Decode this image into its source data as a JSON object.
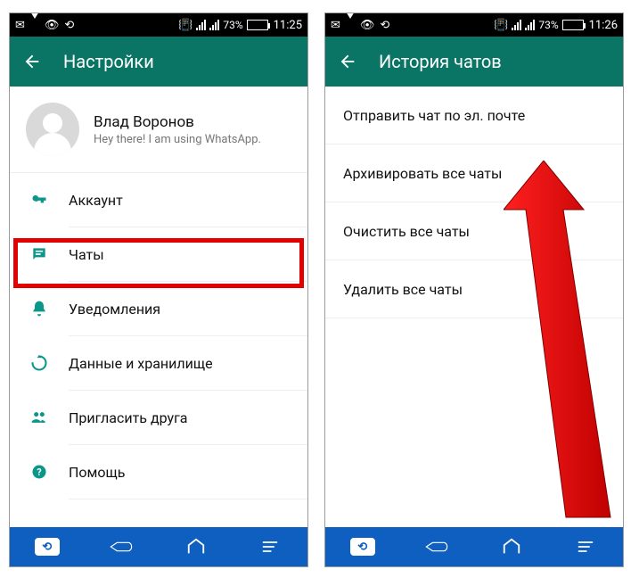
{
  "screen1": {
    "status": {
      "battery": "73%",
      "time": "11:25"
    },
    "appbar": {
      "title": "Настройки"
    },
    "profile": {
      "name": "Влад Воронов",
      "status": "Hey there! I am using WhatsApp."
    },
    "menu": {
      "account": "Аккаунт",
      "chats": "Чаты",
      "notifications": "Уведомления",
      "storage": "Данные и хранилище",
      "invite": "Пригласить друга",
      "help": "Помощь"
    }
  },
  "screen2": {
    "status": {
      "battery": "73%",
      "time": "11:26"
    },
    "appbar": {
      "title": "История чатов"
    },
    "items": {
      "email": "Отправить чат по эл. почте",
      "archive": "Архивировать все чаты",
      "clear": "Очистить все чаты",
      "delete": "Удалить все чаты"
    }
  },
  "colors": {
    "appbar": "#0a7564",
    "accent": "#0a9688",
    "highlight": "#e30000",
    "navbar": "#0e5fbf"
  }
}
